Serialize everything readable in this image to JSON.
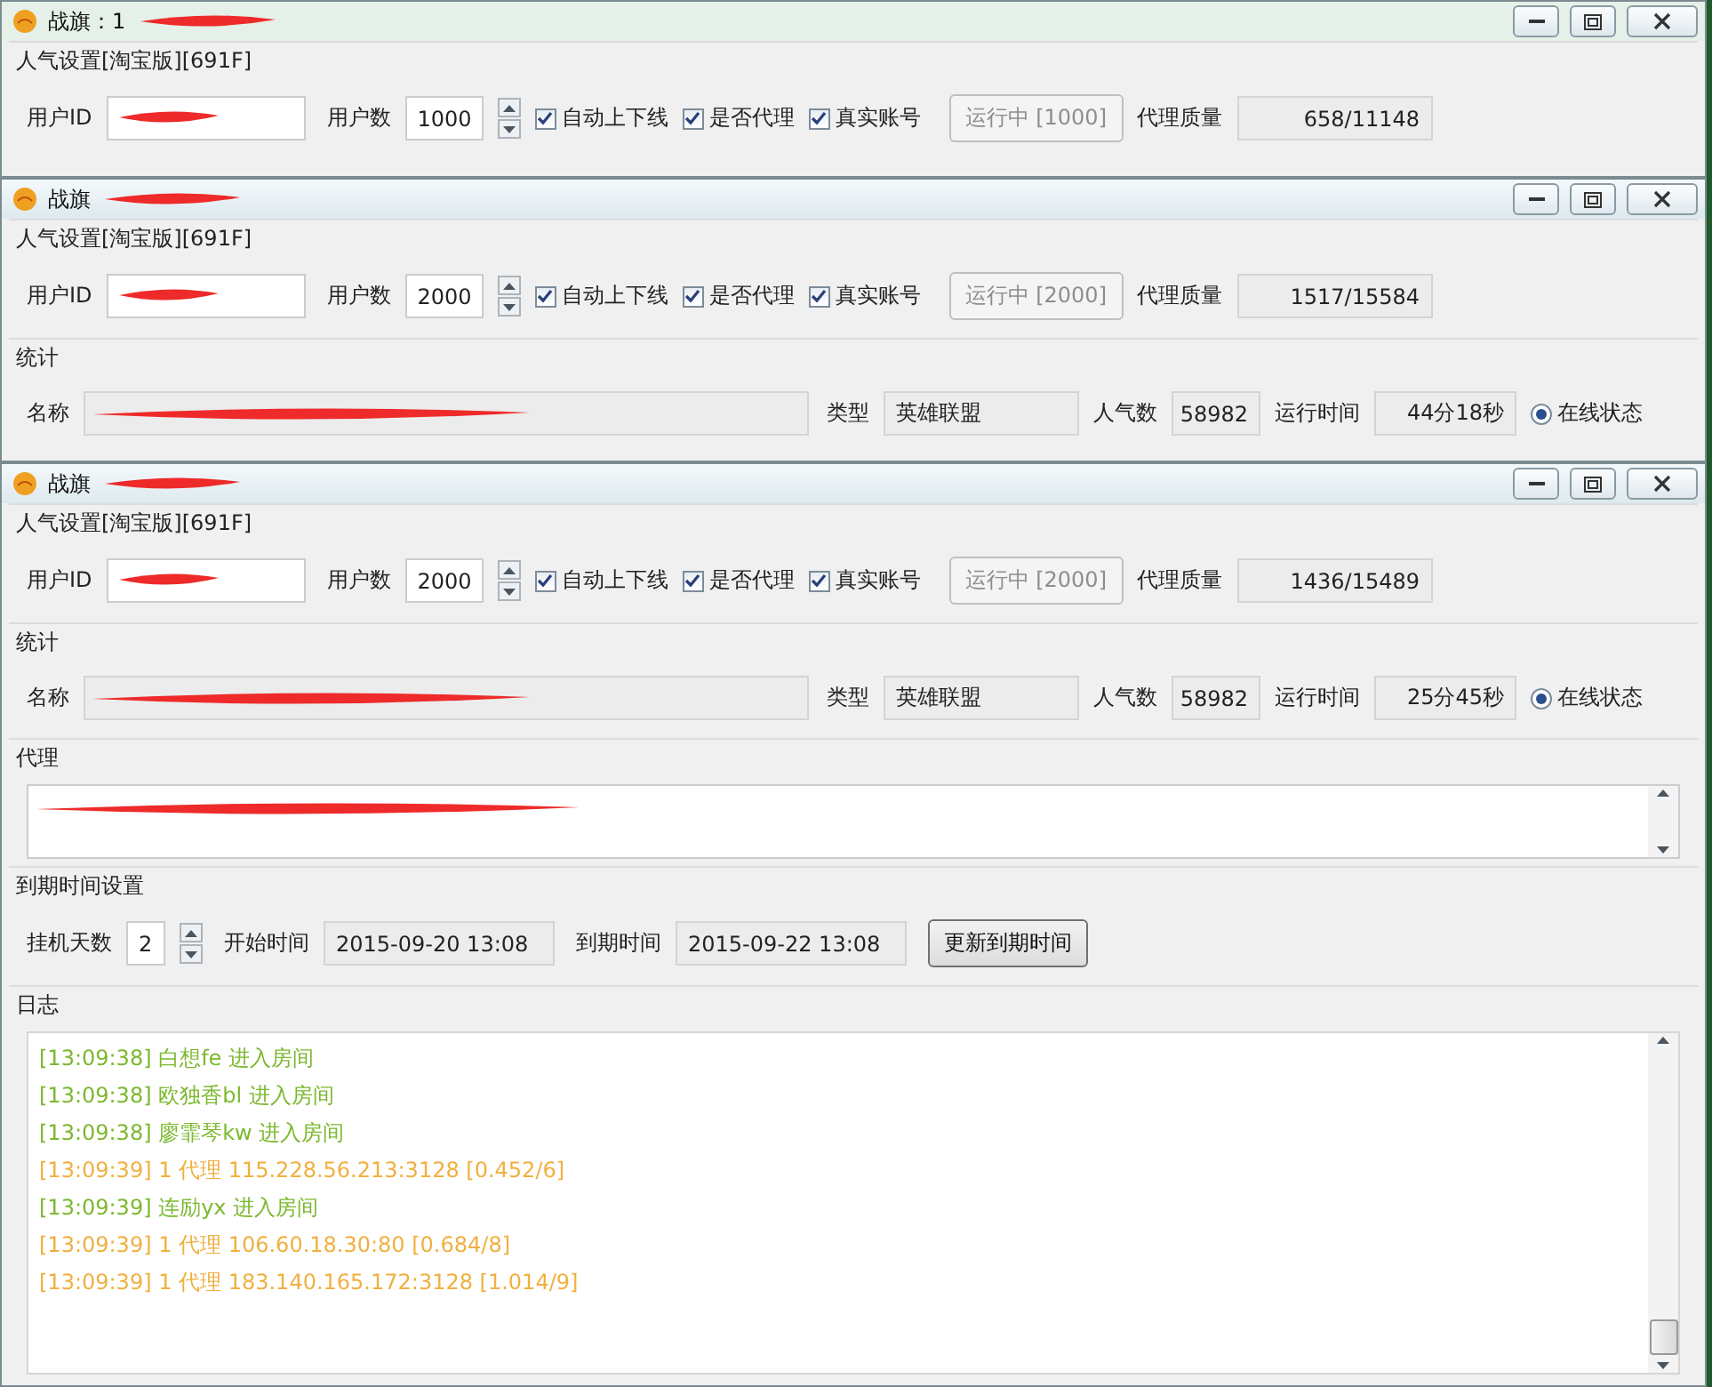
{
  "windows": [
    {
      "title": "战旗：1",
      "settings": {
        "title": "人气设置[淘宝版][691F]",
        "user_id_label": "用户ID",
        "user_count_label": "用户数",
        "user_count": "1000",
        "checkboxes": [
          {
            "label": "自动上下线",
            "checked": true
          },
          {
            "label": "是否代理",
            "checked": true
          },
          {
            "label": "真实账号",
            "checked": true
          }
        ],
        "run_button": {
          "label": "运行中 [1000]",
          "disabled": true
        },
        "quality_label": "代理质量",
        "quality": "658/11148"
      }
    },
    {
      "title": "战旗",
      "settings": {
        "title": "人气设置[淘宝版][691F]",
        "user_id_label": "用户ID",
        "user_count_label": "用户数",
        "user_count": "2000",
        "checkboxes": [
          {
            "label": "自动上下线",
            "checked": true
          },
          {
            "label": "是否代理",
            "checked": true
          },
          {
            "label": "真实账号",
            "checked": true
          }
        ],
        "run_button": {
          "label": "运行中 [2000]",
          "disabled": true
        },
        "quality_label": "代理质量",
        "quality": "1517/15584"
      },
      "stats": {
        "title": "统计",
        "name_label": "名称",
        "type_label": "类型",
        "type": "英雄联盟",
        "popularity_label": "人气数",
        "popularity": "58982",
        "runtime_label": "运行时间",
        "runtime": "44分18秒",
        "online": {
          "label": "在线状态",
          "selected": true
        }
      }
    },
    {
      "title": "战旗",
      "settings": {
        "title": "人气设置[淘宝版][691F]",
        "user_id_label": "用户ID",
        "user_count_label": "用户数",
        "user_count": "2000",
        "checkboxes": [
          {
            "label": "自动上下线",
            "checked": true
          },
          {
            "label": "是否代理",
            "checked": true
          },
          {
            "label": "真实账号",
            "checked": true
          }
        ],
        "run_button": {
          "label": "运行中 [2000]",
          "disabled": true
        },
        "quality_label": "代理质量",
        "quality": "1436/15489"
      },
      "stats": {
        "title": "统计",
        "name_label": "名称",
        "type_label": "类型",
        "type": "英雄联盟",
        "popularity_label": "人气数",
        "popularity": "58982",
        "runtime_label": "运行时间",
        "runtime": "25分45秒",
        "online": {
          "label": "在线状态",
          "selected": true
        }
      },
      "proxy": {
        "title": "代理"
      },
      "expiry": {
        "title": "到期时间设置",
        "days_label": "挂机天数",
        "days": "2",
        "start_label": "开始时间",
        "start": "2015-09-20 13:08",
        "end_label": "到期时间",
        "end": "2015-09-22 13:08",
        "update_button": "更新到期时间"
      },
      "log": {
        "title": "日志",
        "lines": [
          {
            "text": "[13:09:38] 白想fe 进入房间",
            "color": "#7cb82f"
          },
          {
            "text": "[13:09:38] 欧独香bl 进入房间",
            "color": "#7cb82f"
          },
          {
            "text": "[13:09:38] 廖霏琴kw 进入房间",
            "color": "#7cb82f"
          },
          {
            "text": "[13:09:39] 1 代理 115.228.56.213:3128 [0.452/6]",
            "color": "#f0b040"
          },
          {
            "text": "[13:09:39] 连励yx 进入房间",
            "color": "#7cb82f"
          },
          {
            "text": "[13:09:39] 1 代理 106.60.18.30:80 [0.684/8]",
            "color": "#f0b040"
          },
          {
            "text": "[13:09:39] 1 代理 183.140.165.172:3128 [1.014/9]",
            "color": "#f0b040"
          }
        ]
      }
    }
  ]
}
